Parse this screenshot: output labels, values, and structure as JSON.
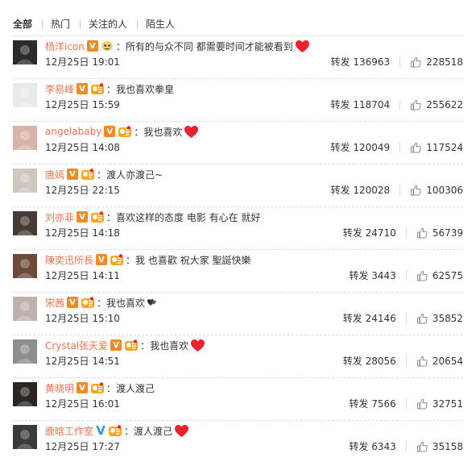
{
  "tabs": [
    "全部",
    "热门",
    "关注的人",
    "陌生人"
  ],
  "repost_label": "转发",
  "comments": [
    {
      "name": "杨洋icon",
      "v": "orange",
      "extra": "star",
      "text": "所有的与众不同 都需要时间才能被看到",
      "heart": true,
      "time": "12月25日 19:01",
      "reposts": "136963",
      "likes": "228518",
      "avatar_color": "#2b2b2b"
    },
    {
      "name": "李易峰",
      "v": "orange",
      "extra": "fans",
      "text": "我也喜欢拳皇",
      "heart": false,
      "time": "12月25日 15:59",
      "reposts": "118704",
      "likes": "255622",
      "avatar_color": "#e9e9e9"
    },
    {
      "name": "angelababy",
      "v": "orange",
      "extra": "fans",
      "text": "我也喜欢",
      "heart": true,
      "time": "12月25日 14:08",
      "reposts": "120049",
      "likes": "117524",
      "avatar_color": "#d9b2a8"
    },
    {
      "name": "唐嫣",
      "v": "orange",
      "extra": "fans",
      "text": "渡人亦渡己~",
      "heart": false,
      "time": "12月25日 22:15",
      "reposts": "120028",
      "likes": "100306",
      "avatar_color": "#cfc6bd"
    },
    {
      "name": "刘亦菲",
      "v": "orange",
      "extra": "fans",
      "text": "喜欢这样的态度 电影 有心在 就好",
      "heart": false,
      "time": "12月25日 14:18",
      "reposts": "24710",
      "likes": "56739",
      "avatar_color": "#4a3a36"
    },
    {
      "name": "陳奕迅所長",
      "v": "orange",
      "extra": "fans",
      "text": "我  也喜歡 祝大家 聖誕快樂",
      "heart": false,
      "time": "12月25日 14:11",
      "reposts": "3443",
      "likes": "62575",
      "avatar_color": "#6b4a3a"
    },
    {
      "name": "宋茜",
      "v": "orange",
      "extra": "fans",
      "text": "我也喜欢",
      "heart": false,
      "blackheart": true,
      "time": "12月25日 15:10",
      "reposts": "24146",
      "likes": "35852",
      "avatar_color": "#bfb1ad"
    },
    {
      "name": "Crystal张天爱",
      "v": "orange",
      "extra": "fans",
      "text": "我也喜欢",
      "heart": true,
      "time": "12月25日 14:51",
      "reposts": "28056",
      "likes": "20654",
      "avatar_color": "#8e8e8e"
    },
    {
      "name": "黄晓明",
      "v": "orange",
      "extra": "fans",
      "text": "渡人渡己",
      "heart": false,
      "time": "12月25日 16:01",
      "reposts": "7566",
      "likes": "32751",
      "avatar_color": "#2a2622"
    },
    {
      "name": "鹿晗工作室",
      "v": "blue",
      "extra": "fans",
      "text": "渡人渡己",
      "heart": true,
      "time": "12月25日 17:27",
      "reposts": "6343",
      "likes": "35158",
      "avatar_color": "#3c3a38"
    }
  ],
  "colors": {
    "username": "#eb7350",
    "v_orange": "#f08a24",
    "v_blue": "#2e9ae6",
    "heart": "#e8232b"
  }
}
